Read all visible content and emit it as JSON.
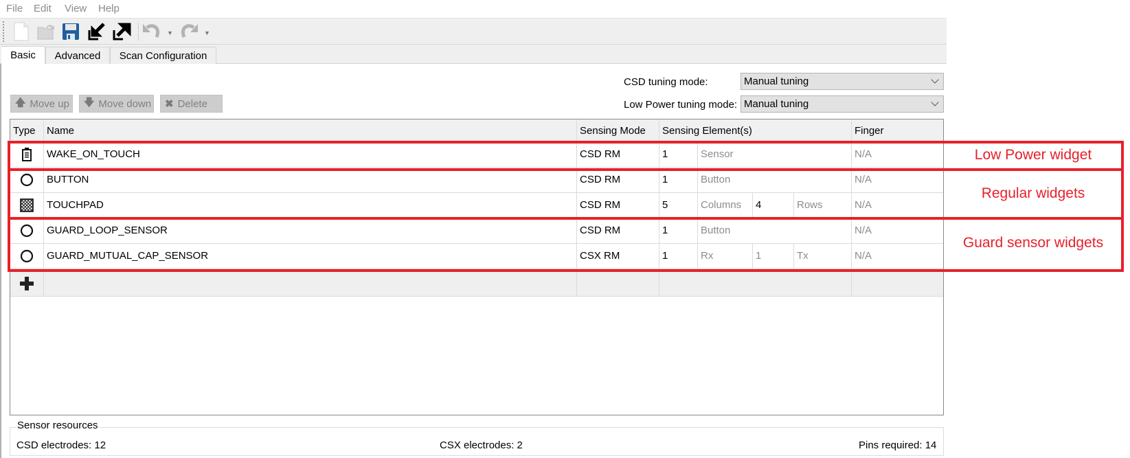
{
  "menu": [
    "File",
    "Edit",
    "View",
    "Help"
  ],
  "toolbar": {
    "buttons": [
      {
        "name": "new",
        "icon": "new-file-icon",
        "enabled": true
      },
      {
        "name": "open",
        "icon": "open-folder-icon",
        "enabled": false
      },
      {
        "name": "save",
        "icon": "save-icon",
        "enabled": true
      },
      {
        "name": "import",
        "icon": "import-icon",
        "enabled": true
      },
      {
        "name": "export",
        "icon": "export-icon",
        "enabled": true
      },
      {
        "name": "undo",
        "icon": "undo-icon",
        "enabled": false
      },
      {
        "name": "redo",
        "icon": "redo-icon",
        "enabled": false
      }
    ]
  },
  "tabs": [
    {
      "label": "Basic",
      "active": true
    },
    {
      "label": "Advanced",
      "active": false
    },
    {
      "label": "Scan Configuration",
      "active": false
    }
  ],
  "tuning": {
    "csd_label": "CSD tuning mode:",
    "csd_value": "Manual tuning",
    "lp_label": "Low Power tuning mode:",
    "lp_value": "Manual tuning"
  },
  "actions": {
    "move_up": "Move up",
    "move_down": "Move down",
    "delete": "Delete"
  },
  "table": {
    "headers": [
      "Type",
      "Name",
      "Sensing Mode",
      "Sensing Element(s)",
      "Finger Capacitance"
    ],
    "rows": [
      {
        "type_icon": "battery-icon",
        "name": "WAKE_ON_TOUCH",
        "mode": "CSD RM",
        "count": "1",
        "label1": "Sensor",
        "count2": "",
        "label2": "",
        "finger": "N/A"
      },
      {
        "type_icon": "circle-icon",
        "name": "BUTTON",
        "mode": "CSD RM",
        "count": "1",
        "label1": "Button",
        "count2": "",
        "label2": "",
        "finger": "N/A"
      },
      {
        "type_icon": "touchpad-icon",
        "name": "TOUCHPAD",
        "mode": "CSD RM",
        "count": "5",
        "label1": "Columns",
        "count2": "4",
        "label2": "Rows",
        "finger": "N/A"
      },
      {
        "type_icon": "circle-icon",
        "name": "GUARD_LOOP_SENSOR",
        "mode": "CSD RM",
        "count": "1",
        "label1": "Button",
        "count2": "",
        "label2": "",
        "finger": "N/A"
      },
      {
        "type_icon": "circle-icon",
        "name": "GUARD_MUTUAL_CAP_SENSOR",
        "mode": "CSX RM",
        "count": "1",
        "label1": "Rx",
        "count2": "1",
        "label2": "Tx",
        "finger": "N/A"
      }
    ],
    "add_icon": "plus-icon"
  },
  "annotations": [
    {
      "label": "Low Power widget",
      "color": "#e8202a"
    },
    {
      "label": "Regular widgets",
      "color": "#e8202a"
    },
    {
      "label": "Guard sensor widgets",
      "color": "#e8202a"
    }
  ],
  "resources": {
    "title": "Sensor resources",
    "csd": "CSD electrodes:  12",
    "csx": "CSX electrodes:  2",
    "pins": "Pins required:  14"
  }
}
